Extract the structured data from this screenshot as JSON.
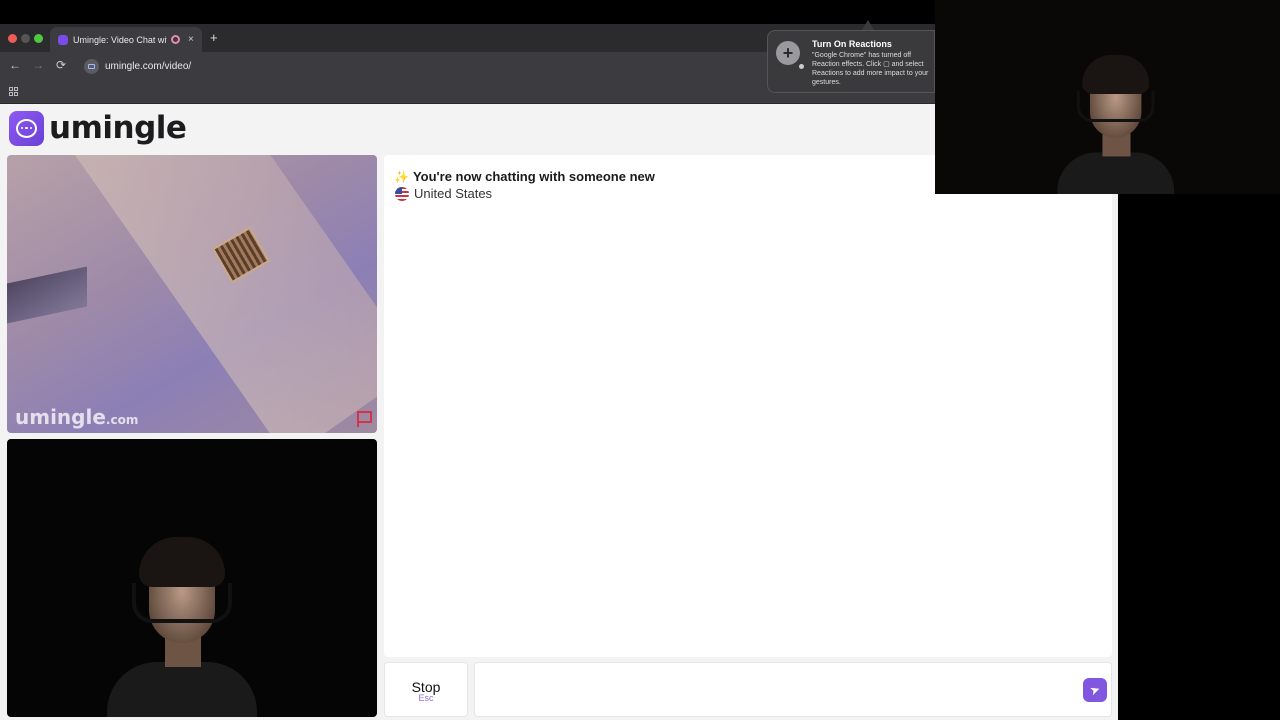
{
  "browser": {
    "tab_title": "Umingle: Video Chat with",
    "tab_close": "×",
    "new_tab": "+",
    "url": "umingle.com/video/",
    "nav": {
      "back": "←",
      "forward": "→",
      "reload": "⟳"
    }
  },
  "notification": {
    "title": "Turn On Reactions",
    "body": "\"Google Chrome\" has turned off\nReaction effects. Click ▢ and select\nReactions to add more impact to your\ngestures."
  },
  "site": {
    "brand": "umingle"
  },
  "remote_video": {
    "watermark": "umingle",
    "watermark_suffix": ".com"
  },
  "chat": {
    "status_message": "You're now chatting with someone new",
    "partner_country": "United States",
    "input_value": "",
    "input_placeholder": ""
  },
  "controls": {
    "stop_label": "Stop",
    "stop_hint": "Esc"
  },
  "colors": {
    "brand": "#7b4ae8",
    "report_flag": "#d3344a",
    "send_button": "#8157e0"
  }
}
